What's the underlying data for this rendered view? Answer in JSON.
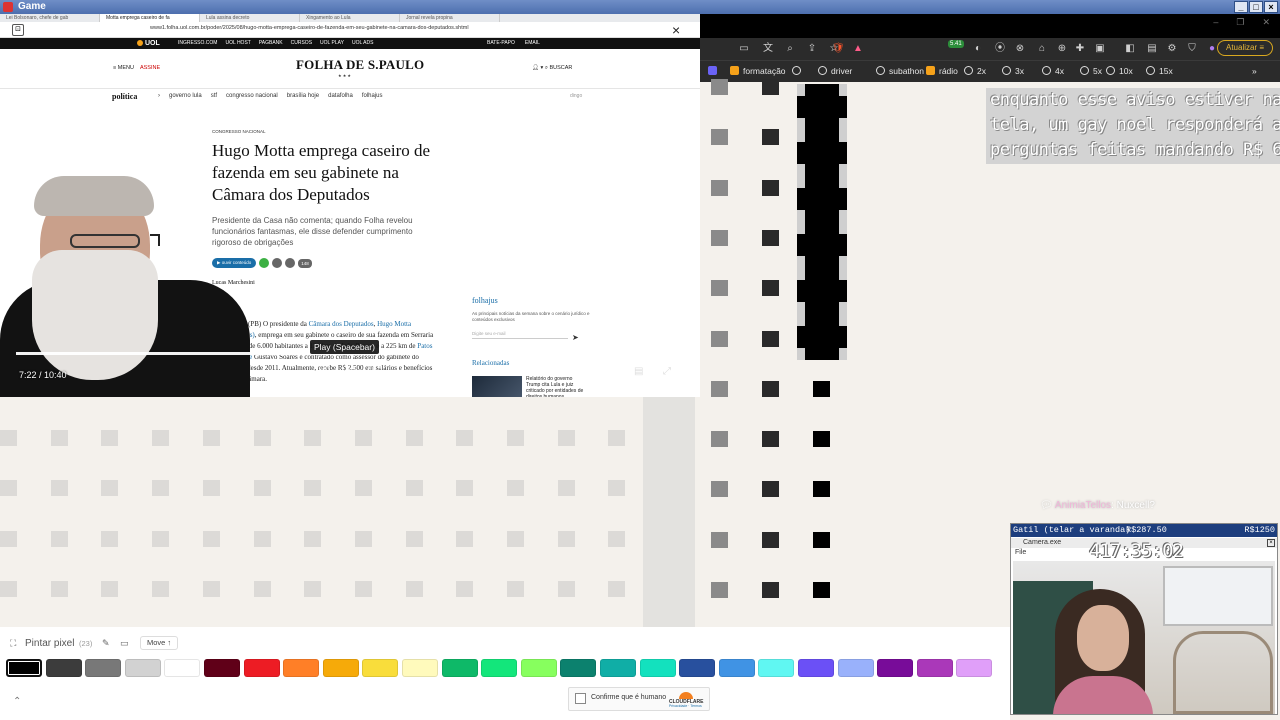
{
  "window": {
    "title": "Game"
  },
  "left_browser": {
    "tabs": [
      "Lei Bolsonaro, chefe de gab",
      "Motta emprega caseiro de fa",
      "Lula assina decreto",
      "Xingamento ao Lula",
      "Jornal revela propina"
    ],
    "url": "www1.folha.uol.com.br/poder/2025/08/hugo-motta-emprega-caseiro-de-fazenda-em-seu-gabinete-na-camara-dos-deputados.shtml",
    "uol_bar": {
      "logo": "UOL",
      "links": [
        "INGRESSO.COM",
        "UOL HOST",
        "PAGBANK",
        "CURSOS",
        "UOL PLAY",
        "UOL ADS"
      ],
      "right": [
        "BATE-PAPO",
        "EMAIL"
      ]
    },
    "header": {
      "menu": "MENU",
      "subscribe": "ASSINE",
      "logo": "FOLHA DE S.PAULO",
      "stars": "★ ★ ★",
      "search": "BUSCAR"
    },
    "nav": {
      "section": "política",
      "items": [
        "governo lula",
        "stf",
        "congresso nacional",
        "brasília hoje",
        "datafolha",
        "folhajus"
      ],
      "right": "dingo"
    },
    "article": {
      "kicker": "Congresso Nacional",
      "title": "Hugo Motta emprega caseiro de fazenda em seu gabinete na Câmara dos Deputados",
      "lede": "Presidente da Casa não comenta; quando Folha revelou funcionários fantasmas, ele disse defender cumprimento rigoroso de obrigações",
      "share_label": "ouvir conteúdo",
      "comments": "148",
      "author": "Lucas Marchesini",
      "body_1": "SERRARIA (PB) O presidente da ",
      "body_link_1": "Câmara dos Deputados",
      "body_2": ", ",
      "body_link_2": "Hugo Motta (Republicanos)",
      "body_3": ", emprega em seu gabinete o caseiro de sua fazenda em Serraria (PB), cidade de 6.000 habitantes a 131 km de João Pessoa e a 225 km de ",
      "body_link_3": "Patos (PB), sua base",
      "body_4": " Gustavo Soares é contratado como assessor do gabinete do parlamentar desde 2011. Atualmente, recebe R$ 2.500 em salários e benefícios pagos pela Câmara."
    },
    "sidebar": {
      "title": "folhajus",
      "desc": "As principais notícias da semana sobre o cenário jurídico e conteúdos exclusivos",
      "email_placeholder": "Digite seu e-mail",
      "related_title": "Relacionadas",
      "related_text": "Relatório do governo Trump cita Lula e juiz criticado por entidades de direitos humanos"
    },
    "video": {
      "time": "7:22 / 10:40",
      "progress": 0.69,
      "tooltip": "Play (Spacebar)"
    }
  },
  "right_browser": {
    "counter": "5.41",
    "update_label": "Atualizar",
    "bookmarks": [
      "formatação",
      "",
      "driver",
      "subathon",
      "rádio",
      "2x",
      "3x",
      "4x",
      "5x",
      "10x",
      "15x"
    ]
  },
  "overlay_text": [
    "enquanto esse aviso estiver na",
    "tela, um gay noel responderá as",
    "perguntas feitas mandando R$ 6"
  ],
  "chat": {
    "name": "AnimiaTellos",
    "message": ": Nuxcell?"
  },
  "obs_widget": {
    "bar_left": "Gatil (telar a varanda)",
    "bar_mid": "R$287.50",
    "bar_right": "R$1250",
    "cam_title": "Camera.exe",
    "file_label": "File",
    "timer": "417:35:02"
  },
  "bottom_bar": {
    "tool_label": "Pintar pixel",
    "tool_count": "(23)",
    "move_label": "Move ↑",
    "captcha_label": "Confirme que é humano",
    "captcha_brand": "CLOUDFLARE",
    "captcha_links": "Privacidade · Termos"
  },
  "palette": [
    "#000000",
    "#3c3c3c",
    "#787878",
    "#d2d2d2",
    "#ffffff",
    "#600018",
    "#ed1c24",
    "#ff7f27",
    "#f6aa09",
    "#f9dd3b",
    "#fffabc",
    "#0eb968",
    "#13e67b",
    "#87ff5e",
    "#0c816e",
    "#10aea6",
    "#13e1be",
    "#28509e",
    "#4093e4",
    "#60f7f2",
    "#6b50f6",
    "#99b1fb",
    "#780c99",
    "#aa38b9",
    "#e09ff9"
  ],
  "selected_color": "#000000"
}
